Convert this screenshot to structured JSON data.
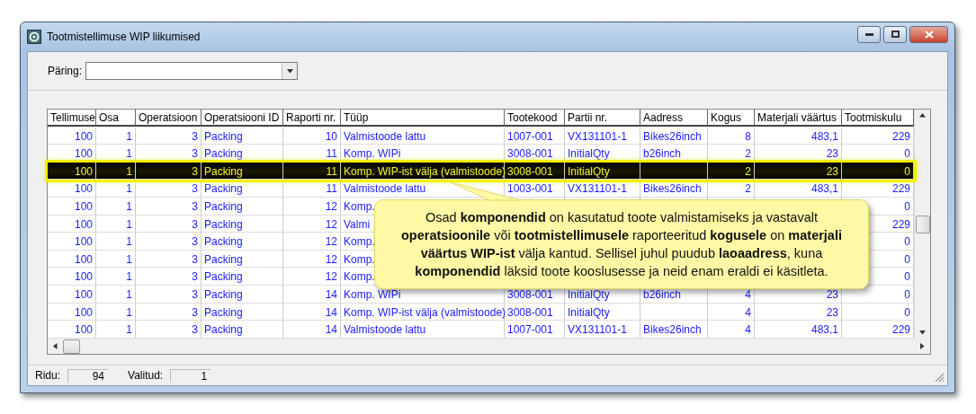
{
  "window": {
    "title": "Tootmistellimuse WIP liikumised"
  },
  "query": {
    "label": "Päring:"
  },
  "table": {
    "columns": [
      "Tellimuse",
      "Osa",
      "Operatsioon",
      "Operatsiooni ID",
      "Raporti nr.",
      "Tüüp",
      "Tootekood",
      "Partii nr.",
      "Aadress",
      "Kogus",
      "Materjali väärtus",
      "Tootmiskulu"
    ],
    "rows": [
      {
        "selected": false,
        "cells": [
          "100",
          "1",
          "3",
          "Packing",
          "10",
          "Valmistoode lattu",
          "1007-001",
          "VX131101-1",
          "Bikes26inch",
          "8",
          "483,1",
          "229"
        ]
      },
      {
        "selected": false,
        "cells": [
          "100",
          "1",
          "3",
          "Packing",
          "11",
          "Komp. WIPi",
          "3008-001",
          "InitialQty",
          "b26inch",
          "2",
          "23",
          "0"
        ]
      },
      {
        "selected": true,
        "cells": [
          "100",
          "1",
          "3",
          "Packing",
          "11",
          "Komp. WIP-ist välja (valmistoode)",
          "3008-001",
          "InitialQty",
          null,
          "2",
          "23",
          "0"
        ]
      },
      {
        "selected": false,
        "cells": [
          "100",
          "1",
          "3",
          "Packing",
          "11",
          "Valmistoode lattu",
          "1003-001",
          "VX131101-1",
          "Bikes26inch",
          "2",
          "483,1",
          "229"
        ]
      },
      {
        "selected": false,
        "cells": [
          "100",
          "1",
          "3",
          "Packing",
          "12",
          "Komp.",
          null,
          null,
          null,
          null,
          null,
          "0"
        ]
      },
      {
        "selected": false,
        "cells": [
          "100",
          "1",
          "3",
          "Packing",
          "12",
          "Valmi",
          null,
          null,
          null,
          null,
          null,
          "229"
        ]
      },
      {
        "selected": false,
        "cells": [
          "100",
          "1",
          "3",
          "Packing",
          "12",
          "Komp.",
          null,
          null,
          null,
          null,
          null,
          "0"
        ]
      },
      {
        "selected": false,
        "cells": [
          "100",
          "1",
          "3",
          "Packing",
          "12",
          "Komp.",
          null,
          null,
          null,
          null,
          null,
          "0"
        ]
      },
      {
        "selected": false,
        "cells": [
          "100",
          "1",
          "3",
          "Packing",
          "12",
          "Komp.",
          null,
          null,
          null,
          null,
          null,
          "0"
        ]
      },
      {
        "selected": false,
        "cells": [
          "100",
          "1",
          "3",
          "Packing",
          "14",
          "Komp. WIPi",
          "3008-001",
          "InitialQty",
          "b26inch",
          "4",
          "23",
          "0"
        ]
      },
      {
        "selected": false,
        "cells": [
          "100",
          "1",
          "3",
          "Packing",
          "14",
          "Komp. WIP-ist välja (valmistoode)",
          "3008-001",
          "InitialQty",
          null,
          "4",
          "23",
          "0"
        ]
      },
      {
        "selected": false,
        "cells": [
          "100",
          "1",
          "3",
          "Packing",
          "14",
          "Valmistoode lattu",
          "1007-001",
          "VX131101-1",
          "Bikes26inch",
          "4",
          "483,1",
          "229"
        ]
      }
    ]
  },
  "callout": {
    "text": "Osad **komponendid**  on kasutatud toote valmistamiseks ja vastavalt **operatsioonile** või **tootmistellimusele** raporteeritud **kogusele** on **materjali väärtus WIP-ist** välja kantud. Sellisel juhul puudub **laoaadress**, kuna **komponendid**  läksid toote kooslusesse ja neid enam eraldi ei käsitleta."
  },
  "status_bar": [
    {
      "label": "Ridu:",
      "value": "94"
    },
    {
      "label": "Valitud:",
      "value": "1"
    }
  ]
}
